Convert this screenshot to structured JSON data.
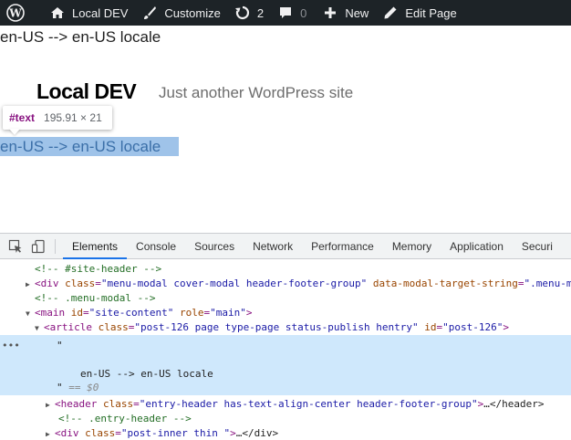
{
  "adminbar": {
    "site_name": "Local DEV",
    "customize": "Customize",
    "updates_count": "2",
    "comments_count": "0",
    "new_label": "New",
    "edit_label": "Edit Page"
  },
  "page": {
    "locale_line_top": "en-US --> en-US locale",
    "site_title": "Local DEV",
    "site_description": "Just another WordPress site",
    "tooltip_name": "#text",
    "tooltip_size": "195.91 × 21",
    "locale_line_selected": "en-US --> en-US locale"
  },
  "devtools": {
    "tabs": [
      "Elements",
      "Console",
      "Sources",
      "Network",
      "Performance",
      "Memory",
      "Application",
      "Securi"
    ],
    "active_tab": "Elements",
    "lines": {
      "l1": "<!-- #site-header -->",
      "l2_tag_open": "<div",
      "l2_attr1": "class",
      "l2_val1": "\"menu-modal cover-modal header-footer-group\"",
      "l2_attr2": "data-modal-target-string",
      "l2_val2": "\".menu-mo",
      "l3": "<!-- .menu-modal -->",
      "l4_tag": "<main",
      "l4_attr1": "id",
      "l4_val1": "\"site-content\"",
      "l4_attr2": "role",
      "l4_val2": "\"main\"",
      "l5_tag": "<article",
      "l5_attr1": "class",
      "l5_val1": "\"post-126 page type-page status-publish hentry\"",
      "l5_attr2": "id",
      "l5_val2": "\"post-126\"",
      "l6": "\"",
      "l7": "en-US --> en-US locale",
      "l8_quote": "\"",
      "l8_eq": "== $0",
      "l9_tag": "<header",
      "l9_attr": "class",
      "l9_val": "\"entry-header has-text-align-center header-footer-group\"",
      "l9_tail": "…</header>",
      "l10": "<!-- .entry-header -->",
      "l11_tag": "<div",
      "l11_attr": "class",
      "l11_val": "\"post-inner thin \"",
      "l11_tail": "…</div>"
    }
  }
}
